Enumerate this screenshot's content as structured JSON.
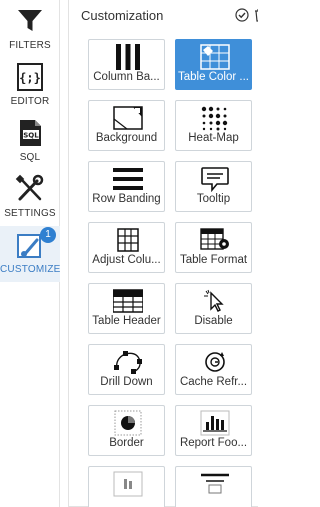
{
  "nav": {
    "items": [
      {
        "label": "FILTERS",
        "icon": "funnel-icon"
      },
      {
        "label": "EDITOR",
        "icon": "code-braces-icon"
      },
      {
        "label": "SQL",
        "icon": "sql-file-icon"
      },
      {
        "label": "SETTINGS",
        "icon": "wrench-screwdriver-icon"
      },
      {
        "label": "CUSTOMIZE",
        "icon": "paint-brush-icon",
        "badge": "1",
        "active": true
      }
    ]
  },
  "panel": {
    "title": "Customization",
    "tiles": [
      {
        "label": "Column Ba...",
        "icon": "column-bars-icon"
      },
      {
        "label": "Table Color ...",
        "icon": "table-color-icon",
        "selected": true
      },
      {
        "label": "Background",
        "icon": "background-image-icon"
      },
      {
        "label": "Heat-Map",
        "icon": "heat-map-icon"
      },
      {
        "label": "Row Banding",
        "icon": "row-banding-icon"
      },
      {
        "label": "Tooltip",
        "icon": "tooltip-icon"
      },
      {
        "label": "Adjust Colu...",
        "icon": "adjust-columns-icon"
      },
      {
        "label": "Table Format",
        "icon": "table-format-icon"
      },
      {
        "label": "Table Header",
        "icon": "table-header-icon"
      },
      {
        "label": "Disable",
        "icon": "disable-cursor-icon"
      },
      {
        "label": "Drill Down",
        "icon": "drill-down-icon"
      },
      {
        "label": "Cache Refr...",
        "icon": "cache-refresh-icon"
      },
      {
        "label": "Border",
        "icon": "border-icon"
      },
      {
        "label": "Report Foo...",
        "icon": "report-footer-icon"
      },
      {
        "label": "",
        "icon": "report-header-icon"
      },
      {
        "label": "",
        "icon": "layout-icon"
      }
    ]
  },
  "colors": {
    "accent": "#3f8fd9",
    "badge": "#2f80d1",
    "active_nav_bg": "#eaf1f8"
  }
}
